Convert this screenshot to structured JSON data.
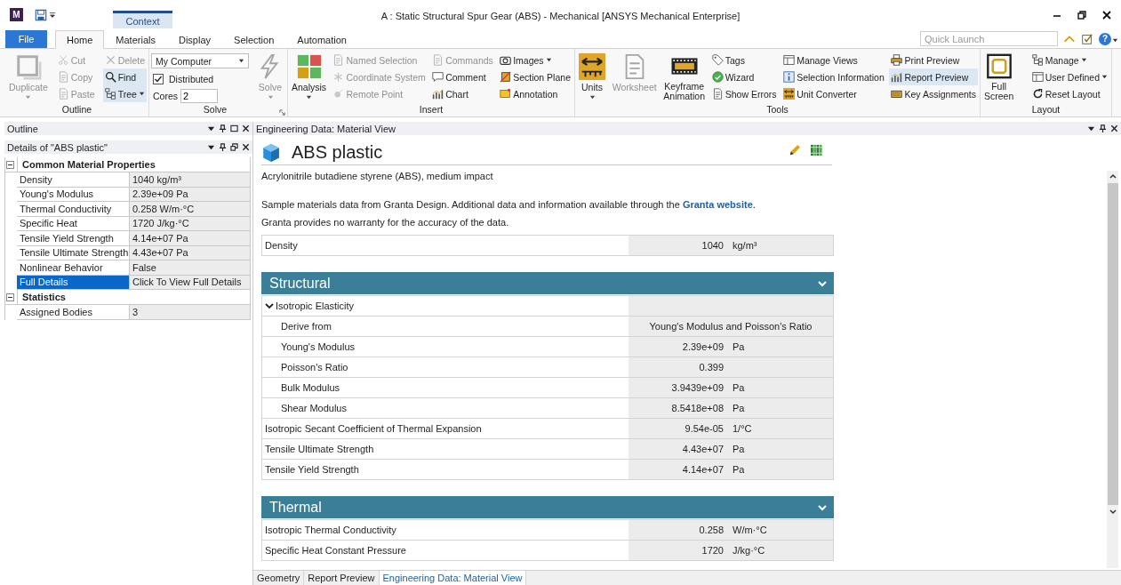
{
  "window": {
    "app_badge": "M",
    "context_tab": "Context",
    "title": "A : Static Structural Spur Gear (ABS) - Mechanical [ANSYS Mechanical Enterprise]",
    "help_label": "?"
  },
  "ribbon_tabs": [
    {
      "label": "File",
      "kind": "file",
      "selected": false
    },
    {
      "label": "Home",
      "kind": "tab",
      "selected": true
    },
    {
      "label": "Materials",
      "kind": "tab",
      "selected": false
    },
    {
      "label": "Display",
      "kind": "tab",
      "selected": false
    },
    {
      "label": "Selection",
      "kind": "tab",
      "selected": false
    },
    {
      "label": "Automation",
      "kind": "tab",
      "selected": false
    }
  ],
  "quick_launch": {
    "placeholder": "Quick Launch"
  },
  "ribbon": {
    "groups": [
      {
        "label": "Outline",
        "has_launcher": false,
        "columns": [
          [
            {
              "kind": "large",
              "label": "Duplicate",
              "disabled": true,
              "highlighted": false,
              "has_menu": true
            }
          ],
          [
            {
              "kind": "small",
              "label": "Cut",
              "disabled": true,
              "highlighted": false,
              "has_menu": false
            },
            {
              "kind": "small",
              "label": "Copy",
              "disabled": true,
              "highlighted": false,
              "has_menu": false
            },
            {
              "kind": "small",
              "label": "Paste",
              "disabled": true,
              "highlighted": false,
              "has_menu": false
            }
          ],
          [
            {
              "kind": "small",
              "label": "Delete",
              "disabled": true,
              "highlighted": false,
              "has_menu": false
            },
            {
              "kind": "small",
              "label": "Find",
              "disabled": false,
              "highlighted": true,
              "has_menu": false
            },
            {
              "kind": "small",
              "label": "Tree",
              "disabled": false,
              "highlighted": true,
              "has_menu": true
            }
          ]
        ]
      },
      {
        "label": "Solve",
        "has_launcher": true,
        "columns": [
          [
            {
              "kind": "select",
              "value": "My Computer"
            },
            {
              "kind": "checkbox",
              "label": "Distributed",
              "checked": true
            },
            {
              "kind": "spin",
              "label": "Cores",
              "value": "2"
            }
          ],
          [
            {
              "kind": "large",
              "label": "Solve",
              "disabled": true,
              "highlighted": false,
              "has_menu": true
            }
          ]
        ]
      },
      {
        "label": "Insert",
        "has_launcher": false,
        "columns": [
          [
            {
              "kind": "large",
              "label": "Analysis",
              "disabled": false,
              "highlighted": false,
              "has_menu": true
            }
          ],
          [
            {
              "kind": "small",
              "label": "Named Selection",
              "disabled": true,
              "highlighted": false,
              "has_menu": false
            },
            {
              "kind": "small",
              "label": "Coordinate System",
              "disabled": true,
              "highlighted": false,
              "has_menu": false
            },
            {
              "kind": "small",
              "label": "Remote Point",
              "disabled": true,
              "highlighted": false,
              "has_menu": false
            }
          ],
          [
            {
              "kind": "small",
              "label": "Commands",
              "disabled": true,
              "highlighted": false,
              "has_menu": false
            },
            {
              "kind": "small",
              "label": "Comment",
              "disabled": false,
              "highlighted": false,
              "has_menu": false
            },
            {
              "kind": "small",
              "label": "Chart",
              "disabled": false,
              "highlighted": false,
              "has_menu": false
            }
          ],
          [
            {
              "kind": "small",
              "label": "Images",
              "disabled": false,
              "highlighted": false,
              "has_menu": true
            },
            {
              "kind": "small",
              "label": "Section Plane",
              "disabled": false,
              "highlighted": false,
              "has_menu": false
            },
            {
              "kind": "small",
              "label": "Annotation",
              "disabled": false,
              "highlighted": false,
              "has_menu": false
            }
          ]
        ]
      },
      {
        "label": "Tools",
        "has_launcher": false,
        "columns": [
          [
            {
              "kind": "large",
              "label": "Units",
              "disabled": false,
              "highlighted": false,
              "has_menu": true
            }
          ],
          [
            {
              "kind": "large",
              "label": "Worksheet",
              "disabled": true,
              "highlighted": false,
              "has_menu": false
            }
          ],
          [
            {
              "kind": "large",
              "label": "Keyframe Animation",
              "disabled": false,
              "highlighted": false,
              "has_menu": false
            }
          ],
          [
            {
              "kind": "small",
              "label": "Tags",
              "disabled": false,
              "highlighted": false,
              "has_menu": false
            },
            {
              "kind": "small",
              "label": "Wizard",
              "disabled": false,
              "highlighted": false,
              "has_menu": false
            },
            {
              "kind": "small",
              "label": "Show Errors",
              "disabled": false,
              "highlighted": false,
              "has_menu": false
            }
          ],
          [
            {
              "kind": "small",
              "label": "Manage Views",
              "disabled": false,
              "highlighted": false,
              "has_menu": false
            },
            {
              "kind": "small",
              "label": "Selection Information",
              "disabled": false,
              "highlighted": false,
              "has_menu": false
            },
            {
              "kind": "small",
              "label": "Unit Converter",
              "disabled": false,
              "highlighted": false,
              "has_menu": false
            }
          ],
          [
            {
              "kind": "small",
              "label": "Print Preview",
              "disabled": false,
              "highlighted": false,
              "has_menu": false
            },
            {
              "kind": "small",
              "label": "Report Preview",
              "disabled": false,
              "highlighted": true,
              "has_menu": false
            },
            {
              "kind": "small",
              "label": "Key Assignments",
              "disabled": false,
              "highlighted": false,
              "has_menu": false
            }
          ]
        ]
      },
      {
        "label": "Layout",
        "has_launcher": false,
        "columns": [
          [
            {
              "kind": "large",
              "label": "Full Screen",
              "disabled": false,
              "highlighted": false,
              "has_menu": false
            }
          ],
          [
            {
              "kind": "small",
              "label": "Manage",
              "disabled": false,
              "highlighted": false,
              "has_menu": true
            },
            {
              "kind": "small",
              "label": "User Defined",
              "disabled": false,
              "highlighted": false,
              "has_menu": true
            },
            {
              "kind": "small",
              "label": "Reset Layout",
              "disabled": false,
              "highlighted": false,
              "has_menu": false
            }
          ]
        ]
      }
    ]
  },
  "outline_panel": {
    "title": "Outline"
  },
  "details_panel": {
    "title": "Details of \"ABS plastic\"",
    "sections": [
      {
        "title": "Common Material Properties",
        "expanded": true,
        "rows": [
          {
            "name": "Density",
            "value": "1040 kg/m³",
            "selected": false
          },
          {
            "name": "Young's Modulus",
            "value": "2.39e+09 Pa",
            "selected": false
          },
          {
            "name": "Thermal Conductivity",
            "value": "0.258 W/m·°C",
            "selected": false
          },
          {
            "name": "Specific Heat",
            "value": "1720 J/kg·°C",
            "selected": false
          },
          {
            "name": "Tensile Yield Strength",
            "value": "4.14e+07 Pa",
            "selected": false
          },
          {
            "name": "Tensile Ultimate Strength",
            "value": "4.43e+07 Pa",
            "selected": false
          },
          {
            "name": "Nonlinear Behavior",
            "value": "False",
            "selected": false
          },
          {
            "name": "Full Details",
            "value": "Click To View Full Details",
            "selected": true
          }
        ]
      },
      {
        "title": "Statistics",
        "expanded": true,
        "rows": [
          {
            "name": "Assigned Bodies",
            "value": "3",
            "selected": false
          }
        ]
      }
    ]
  },
  "material_view": {
    "title": "Engineering Data: Material View",
    "material": "ABS plastic",
    "description": "Acrylonitrile butadiene styrene (ABS), medium impact",
    "note": {
      "before": "Sample materials data from Granta Design. Additional data and information available through the ",
      "link": "Granta website",
      "after": "."
    },
    "disclaimer": "Granta provides no warranty for the accuracy of the data.",
    "summary": [
      {
        "kind": "property",
        "name": "Density",
        "value": "1040",
        "unit": "kg/m³"
      }
    ],
    "sections": [
      {
        "title": "Structural",
        "expanded": true,
        "rows": [
          {
            "kind": "group",
            "name": "Isotropic Elasticity",
            "expanded": true,
            "children": [
              {
                "kind": "option",
                "name": "Derive from",
                "value": "Young's Modulus and Poisson's Ratio"
              },
              {
                "kind": "property",
                "name": "Young's Modulus",
                "value": "2.39e+09",
                "unit": "Pa"
              },
              {
                "kind": "property",
                "name": "Poisson's Ratio",
                "value": "0.399"
              },
              {
                "kind": "property",
                "name": "Bulk Modulus",
                "value": "3.9439e+09",
                "unit": "Pa"
              },
              {
                "kind": "property",
                "name": "Shear Modulus",
                "value": "8.5418e+08",
                "unit": "Pa"
              }
            ]
          },
          {
            "kind": "property",
            "name": "Isotropic Secant Coefficient of Thermal Expansion",
            "value": "9.54e-05",
            "unit": "1/°C"
          },
          {
            "kind": "property",
            "name": "Tensile Ultimate Strength",
            "value": "4.43e+07",
            "unit": "Pa"
          },
          {
            "kind": "property",
            "name": "Tensile Yield Strength",
            "value": "4.14e+07",
            "unit": "Pa"
          }
        ]
      },
      {
        "title": "Thermal",
        "expanded": true,
        "rows": [
          {
            "kind": "property",
            "name": "Isotropic Thermal Conductivity",
            "value": "0.258",
            "unit": "W/m·°C"
          },
          {
            "kind": "property",
            "name": "Specific Heat Constant Pressure",
            "value": "1720",
            "unit": "J/kg·°C"
          }
        ]
      }
    ]
  },
  "bottom_tabs": [
    {
      "label": "Geometry",
      "selected": false
    },
    {
      "label": "Report Preview",
      "selected": false
    },
    {
      "label": "Engineering Data: Material View",
      "selected": true
    }
  ]
}
